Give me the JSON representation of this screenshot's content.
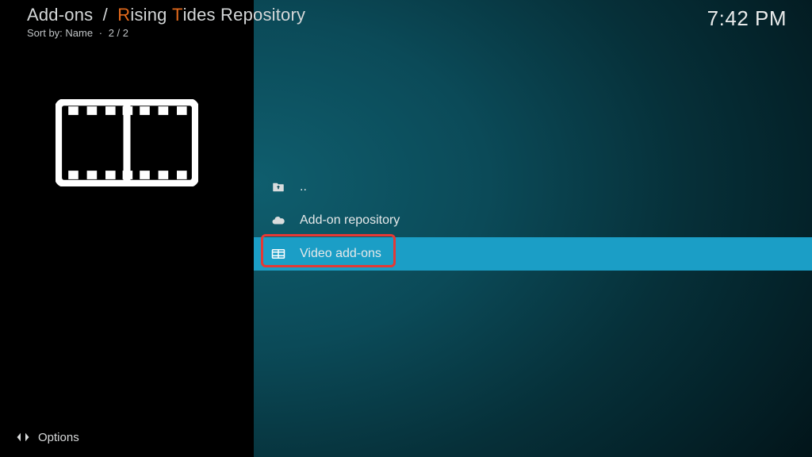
{
  "breadcrumb": {
    "seg1": "Add-ons",
    "separator": "/",
    "seg2_hl1": "R",
    "seg2_mid": "ising ",
    "seg2_hl2": "T",
    "seg2_rest": "ides Repository"
  },
  "sort": {
    "label": "Sort by:",
    "value": "Name",
    "count": "2 / 2"
  },
  "clock": "7:42 PM",
  "list": {
    "items": [
      {
        "icon": "folder-up",
        "label": ".."
      },
      {
        "icon": "cloud",
        "label": "Add-on repository"
      },
      {
        "icon": "film",
        "label": "Video add-ons",
        "selected": true
      }
    ]
  },
  "footer": {
    "options": "Options"
  }
}
